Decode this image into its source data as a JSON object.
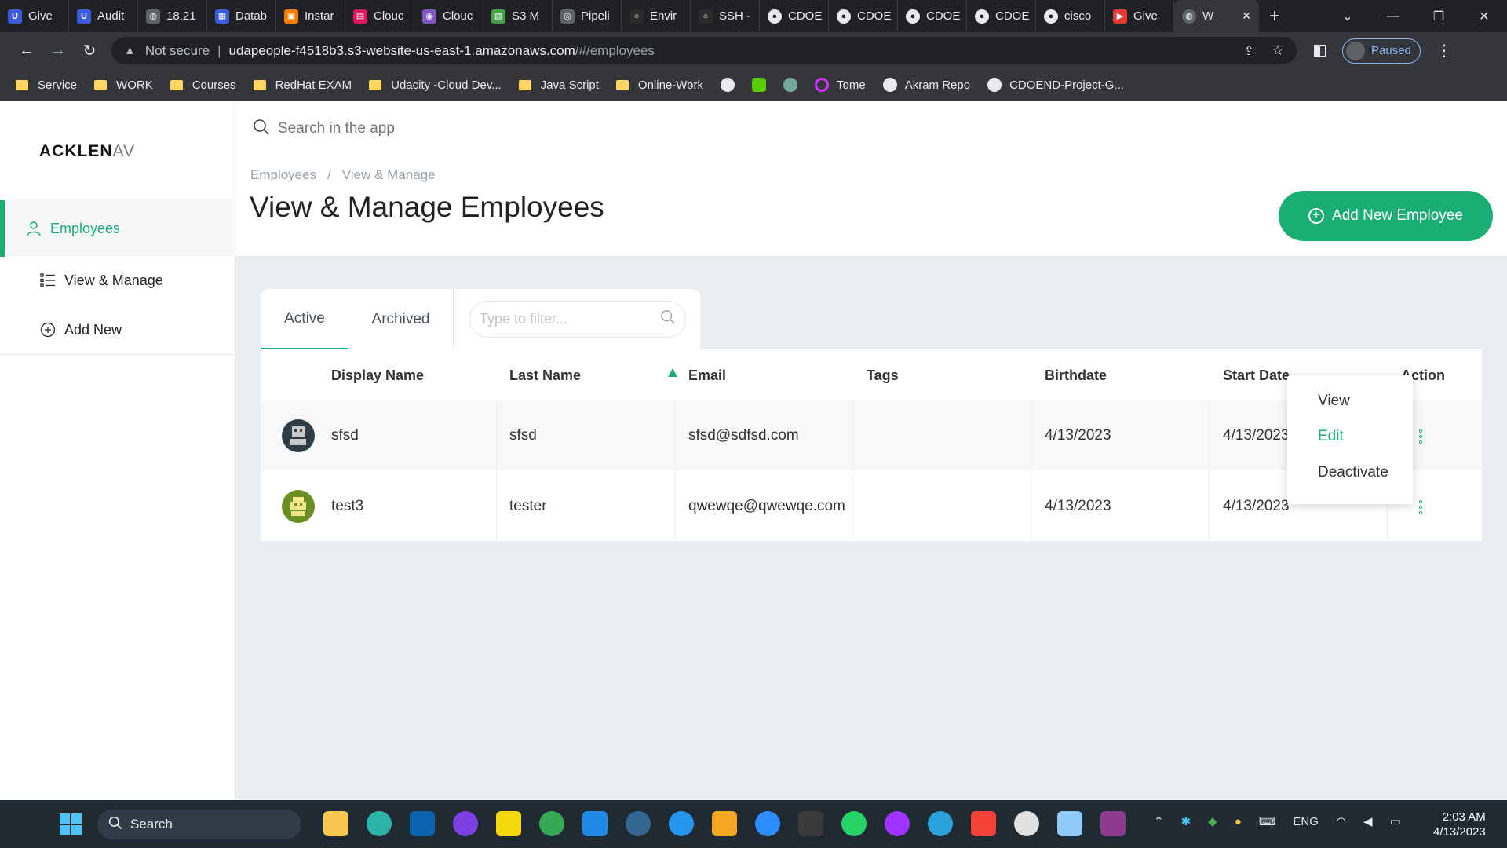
{
  "browser": {
    "tabs": [
      {
        "label": "Give",
        "color": "#3b5bdb"
      },
      {
        "label": "Audit",
        "color": "#3b5bdb"
      },
      {
        "label": "18.21",
        "color": "#5f6368"
      },
      {
        "label": "Datab",
        "color": "#3b5bdb"
      },
      {
        "label": "Instar",
        "color": "#f57c00"
      },
      {
        "label": "Clouc",
        "color": "#d81b60"
      },
      {
        "label": "Clouc",
        "color": "#7e57c2"
      },
      {
        "label": "S3 M",
        "color": "#43a047"
      },
      {
        "label": "Pipeli",
        "color": "#5f6368"
      },
      {
        "label": "Envir",
        "color": "#5f6368"
      },
      {
        "label": "SSH -",
        "color": "#5f6368"
      },
      {
        "label": "CDOE",
        "color": "#5f6368"
      },
      {
        "label": "CDOE",
        "color": "#5f6368"
      },
      {
        "label": "CDOE",
        "color": "#5f6368"
      },
      {
        "label": "CDOE",
        "color": "#5f6368"
      },
      {
        "label": "cisco",
        "color": "#5f6368"
      },
      {
        "label": "Give",
        "color": "#e53935"
      }
    ],
    "active_tab": {
      "label": "W"
    },
    "address": {
      "security": "Not secure",
      "host": "udapeople-f4518b3.s3-website-us-east-1.amazonaws.com",
      "path": "/#/employees"
    },
    "profile": "Paused",
    "bookmarks": [
      {
        "label": "Service",
        "type": "folder"
      },
      {
        "label": "WORK",
        "type": "folder"
      },
      {
        "label": "Courses",
        "type": "folder"
      },
      {
        "label": "RedHat EXAM",
        "type": "folder"
      },
      {
        "label": "Udacity -Cloud Dev...",
        "type": "folder"
      },
      {
        "label": "Java Script",
        "type": "folder"
      },
      {
        "label": "Online-Work",
        "type": "folder"
      },
      {
        "label": "Tome",
        "type": "site"
      },
      {
        "label": "Akram Repo",
        "type": "github"
      },
      {
        "label": "CDOEND-Project-G...",
        "type": "github"
      }
    ]
  },
  "app": {
    "logo": {
      "main": "ACKLEN",
      "fade": "AV"
    },
    "sidebar": {
      "section": "Employees",
      "items": [
        {
          "label": "View & Manage"
        },
        {
          "label": "Add New"
        }
      ]
    },
    "search": {
      "placeholder": "Search in the app"
    },
    "breadcrumb": [
      "Employees",
      "View & Manage"
    ],
    "title": "View & Manage Employees",
    "add_button": "Add New Employee",
    "tabs": {
      "active": "Active",
      "archived": "Archived"
    },
    "filter": {
      "placeholder": "Type to filter..."
    },
    "table": {
      "columns": [
        "Display Name",
        "Last Name",
        "Email",
        "Tags",
        "Birthdate",
        "Start Date",
        "Action"
      ],
      "rows": [
        {
          "display_name": "sfsd",
          "last_name": "sfsd",
          "email": "sfsd@sdfsd.com",
          "tags": "",
          "birthdate": "4/13/2023",
          "start_date": "4/13/2023",
          "avatar_color": "#2f3b45"
        },
        {
          "display_name": "test3",
          "last_name": "tester",
          "email": "qwewqe@qwewqe.com",
          "tags": "",
          "birthdate": "4/13/2023",
          "start_date": "4/13/2023",
          "avatar_color": "#6b8e23"
        }
      ]
    },
    "action_menu": [
      "View",
      "Edit",
      "Deactivate"
    ]
  },
  "taskbar": {
    "search": "Search",
    "tray": {
      "lang": "ENG"
    },
    "time": "2:03 AM",
    "date": "4/13/2023"
  },
  "colors": {
    "accent": "#1aae75"
  }
}
